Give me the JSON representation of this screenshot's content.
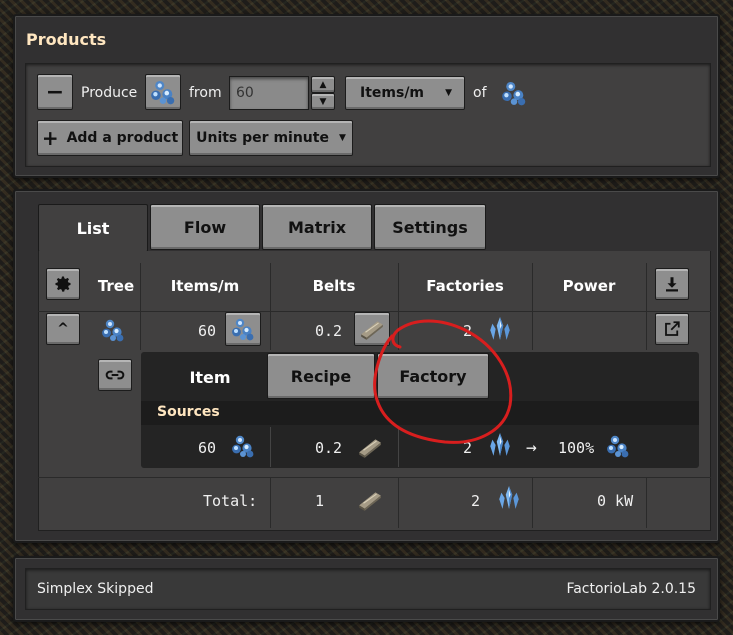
{
  "products": {
    "title": "Products",
    "produce_label": "Produce",
    "from_label": "from",
    "rate_value": "60",
    "rate_unit": "Items/m",
    "of_label": "of",
    "add_product_label": "Add a product",
    "units_select": "Units per minute",
    "remove_label": "−",
    "item_icon": "crystal-cluster-icon"
  },
  "tabs": [
    {
      "label": "List",
      "active": true
    },
    {
      "label": "Flow",
      "active": false
    },
    {
      "label": "Matrix",
      "active": false
    },
    {
      "label": "Settings",
      "active": false
    }
  ],
  "table": {
    "headers": {
      "tree": "Tree",
      "items": "Items/m",
      "belts": "Belts",
      "factories": "Factories",
      "power": "Power"
    },
    "row": {
      "items": "60",
      "belts": "0.2",
      "factories": "2"
    },
    "sub_tabs": [
      {
        "label": "Item",
        "active": true
      },
      {
        "label": "Recipe",
        "active": false
      },
      {
        "label": "Factory",
        "active": false
      }
    ],
    "sources_label": "Sources",
    "source_row": {
      "items": "60",
      "belts": "0.2",
      "factories": "2",
      "arrow": "→",
      "percent": "100%"
    },
    "total": {
      "label": "Total:",
      "belts": "1",
      "factories": "2",
      "power": "0 kW"
    }
  },
  "status": {
    "message": "Simplex Skipped",
    "version": "FactorioLab 2.0.15"
  },
  "colors": {
    "accent_title": "#ffe6c0",
    "annotation_red": "#d81e1e",
    "crystal_blue": "#6fa8e8"
  }
}
